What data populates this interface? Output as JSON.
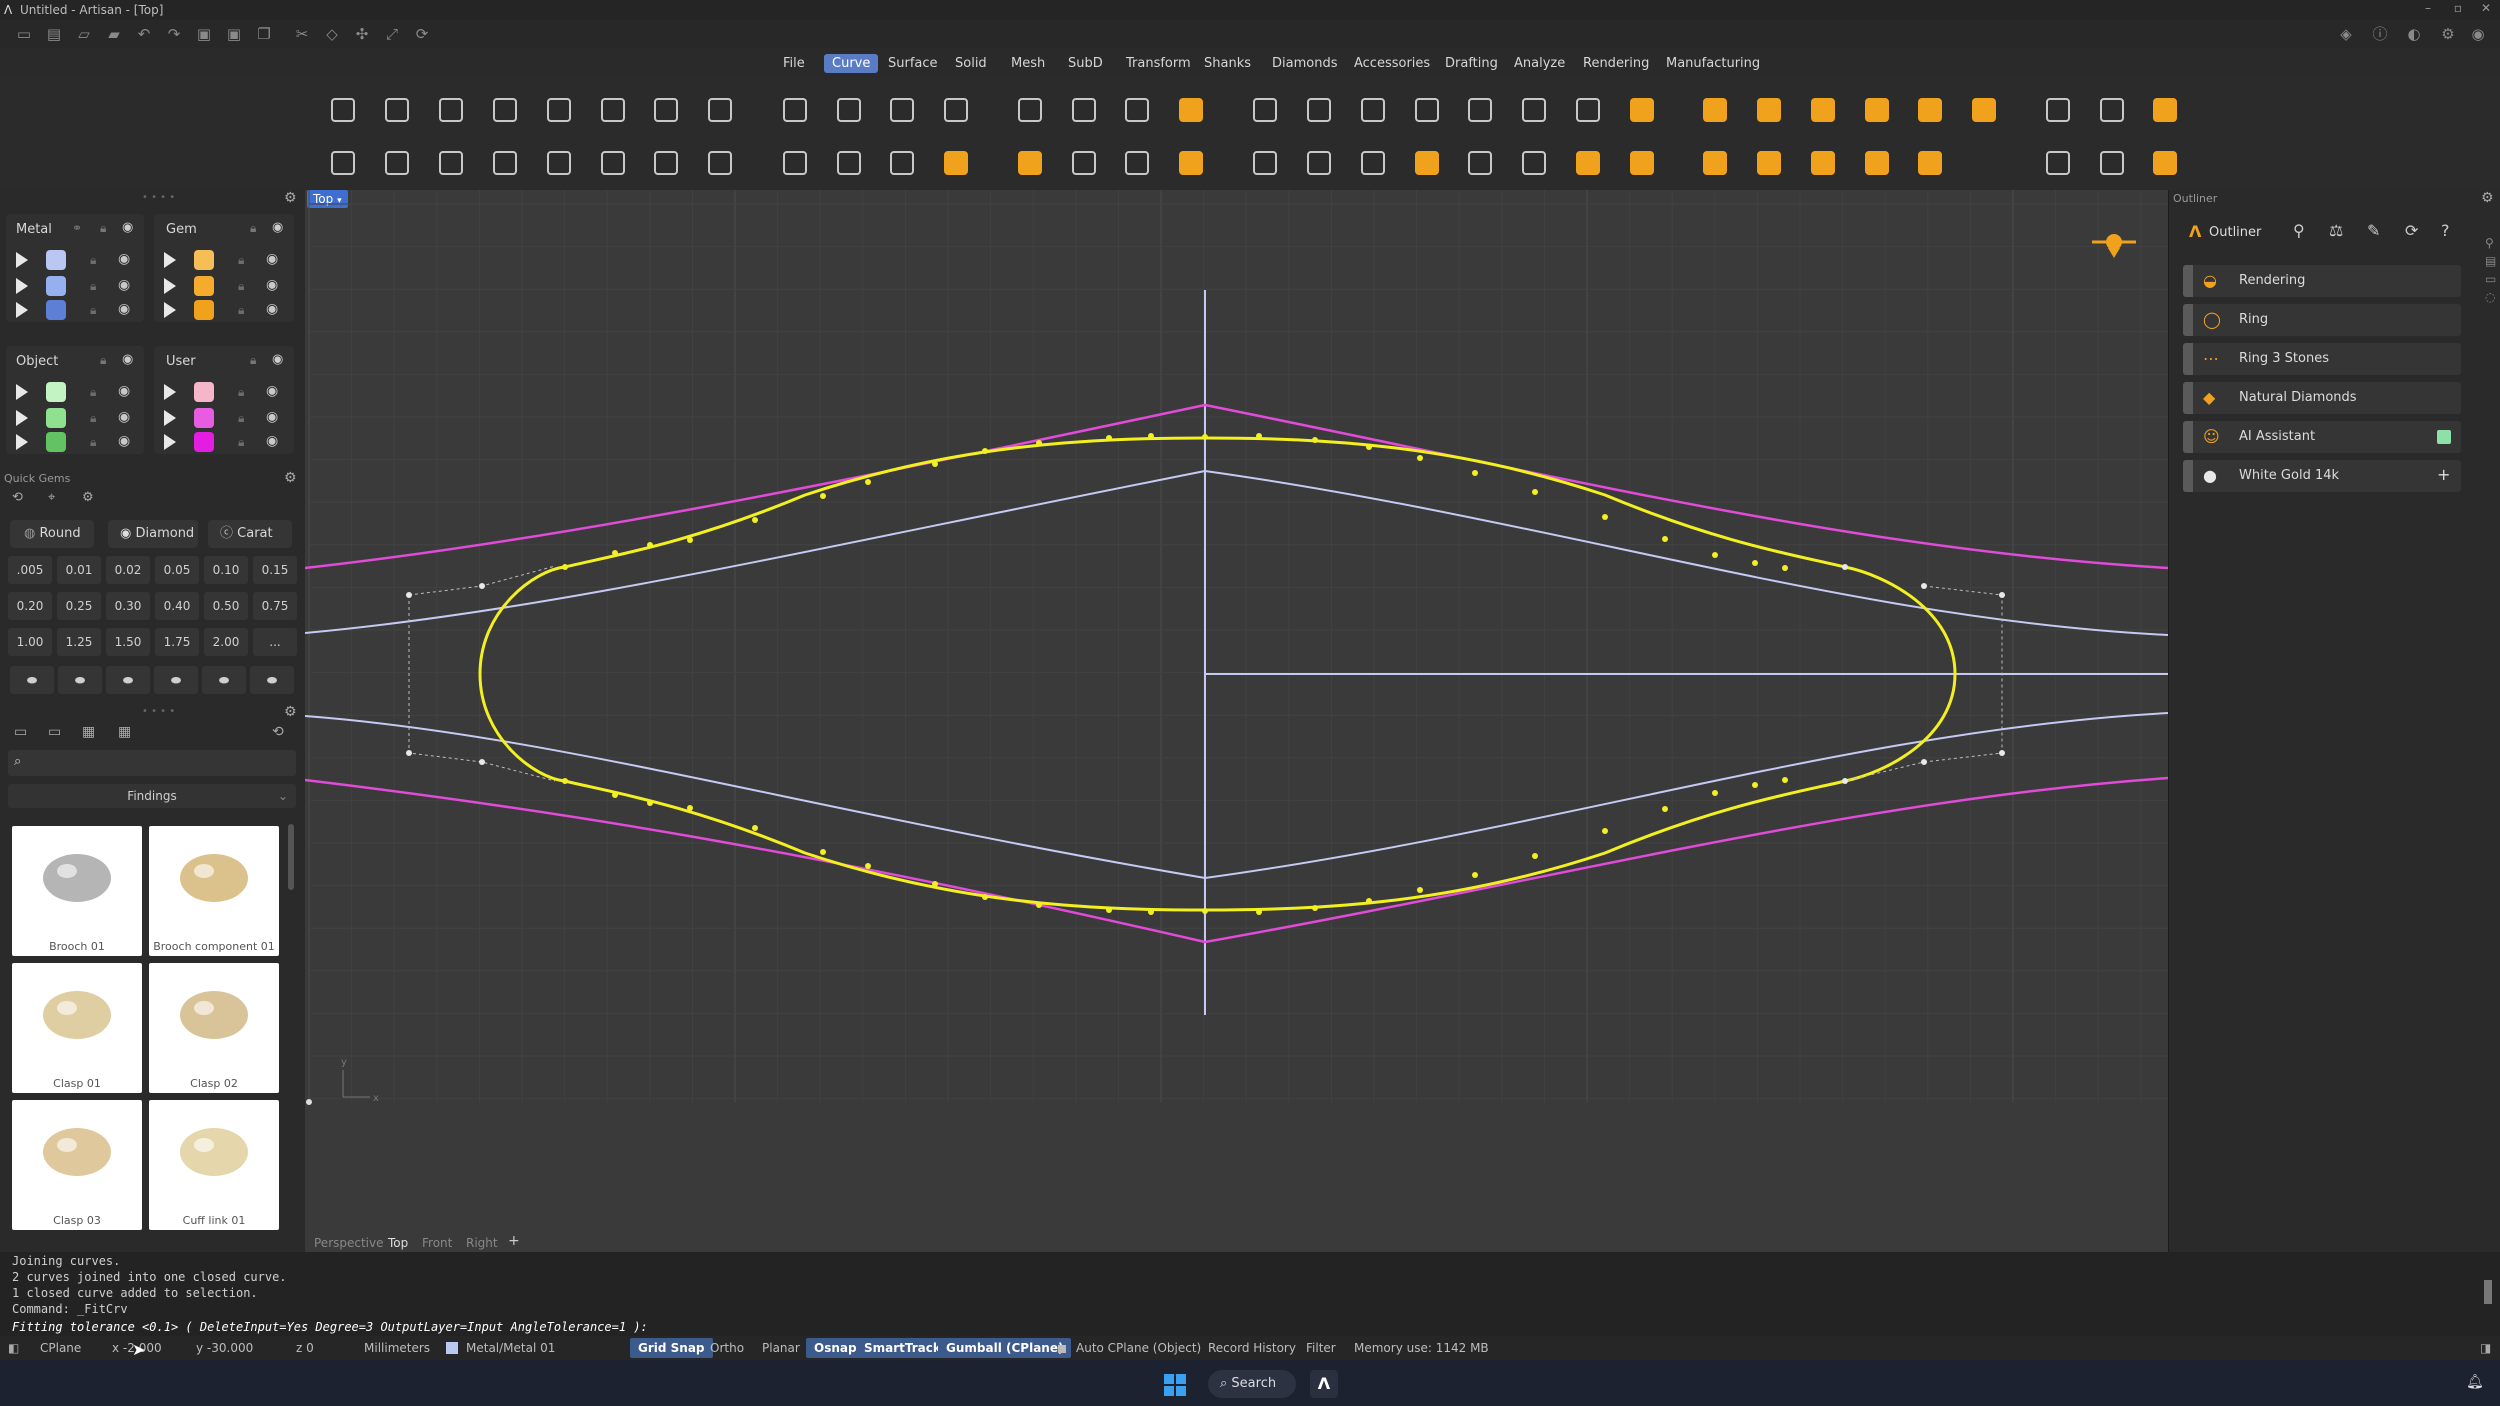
{
  "window": {
    "title": "Untitled - Artisan - [Top]"
  },
  "menu": [
    "File",
    "Curve",
    "Surface",
    "Solid",
    "Mesh",
    "SubD",
    "Transform",
    "Shanks",
    "Diamonds",
    "Accessories",
    "Drafting",
    "Analyze",
    "Rendering",
    "Manufacturing"
  ],
  "menu_active": "Curve",
  "layers": {
    "metal": {
      "title": "Metal",
      "colors": [
        "#b9c7f2",
        "#95b0ef",
        "#5e7fd6"
      ]
    },
    "gem": {
      "title": "Gem",
      "colors": [
        "#f5be57",
        "#f5ac2e",
        "#f0a21c"
      ]
    },
    "object": {
      "title": "Object",
      "colors": [
        "#c3f2c3",
        "#8fe08f",
        "#63c363"
      ]
    },
    "user": {
      "title": "User",
      "colors": [
        "#f4b6c8",
        "#e85ce2",
        "#e31ee0"
      ]
    }
  },
  "quick_gems": {
    "title": "Quick Gems",
    "shapes": [
      "Round",
      "Diamond",
      "Carat"
    ],
    "sizes": [
      ".005",
      "0.01",
      "0.02",
      "0.05",
      "0.10",
      "0.15",
      "0.20",
      "0.25",
      "0.30",
      "0.40",
      "0.50",
      "0.75",
      "1.00",
      "1.25",
      "1.50",
      "1.75",
      "2.00",
      "..."
    ]
  },
  "library": {
    "category": "Findings",
    "items": [
      "Brooch 01",
      "Brooch component 01",
      "Clasp 01",
      "Clasp 02",
      "Clasp 03",
      "Cuff link 01"
    ]
  },
  "viewport": {
    "label": "Top",
    "tabs": [
      "Perspective",
      "Top",
      "Front",
      "Right"
    ],
    "active_tab": "Top",
    "add_tab": "+"
  },
  "outliner": {
    "title": "Outliner",
    "panel_label": "Outliner",
    "items": [
      "Rendering",
      "Ring",
      "Ring 3 Stones",
      "Natural Diamonds",
      "AI Assistant",
      "White Gold 14k"
    ]
  },
  "command_history": [
    "Joining curves.",
    "2 curves joined into one closed curve.",
    "1 closed curve added to selection.",
    "Command: _FitCrv"
  ],
  "command_prompt": "Fitting tolerance <0.1> ( DeleteInput=Yes  Degree=3  OutputLayer=Input  AngleTolerance=1 ):",
  "status": {
    "cplane": "CPlane",
    "x": "x -2.000",
    "y": "y -30.000",
    "z": "z 0",
    "units": "Millimeters",
    "layer": "Metal/Metal 01",
    "grid_snap": "Grid Snap",
    "ortho": "Ortho",
    "planar": "Planar",
    "osnap": "Osnap",
    "smarttrack": "SmartTrack",
    "gumball": "Gumball (CPlane)",
    "auto_cplane": "Auto CPlane (Object)",
    "record_history": "Record History",
    "filter": "Filter",
    "memory": "Memory use: 1142 MB"
  },
  "taskbar": {
    "search": "Search"
  },
  "colors": {
    "accent": "#5a7cc4",
    "curve_yellow": "#f3f021",
    "curve_magenta": "#e04bd8",
    "curve_lavender": "#c6c9f2",
    "orange_tool": "#f0a21c"
  }
}
